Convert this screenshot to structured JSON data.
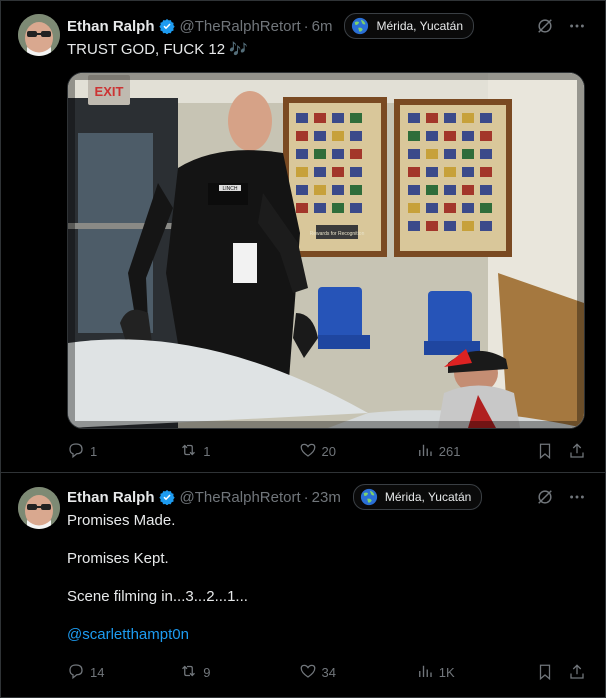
{
  "tweets": [
    {
      "author": {
        "name": "Ethan Ralph",
        "handle": "@TheRalphRetort"
      },
      "time": "6m",
      "location": "Mérida, Yucatán",
      "text": "TRUST GOD, FUCK 12 🎶",
      "media": {
        "exit_sign": "EXIT",
        "name_tag": "LINCH",
        "plaque": "Rewards for Recognition"
      },
      "stats": {
        "replies": "1",
        "reposts": "1",
        "likes": "20",
        "views": "261"
      }
    },
    {
      "author": {
        "name": "Ethan Ralph",
        "handle": "@TheRalphRetort"
      },
      "time": "23m",
      "location": "Mérida, Yucatán",
      "lines": [
        "Promises Made.",
        "Promises Kept.",
        "Scene filming in...3...2...1..."
      ],
      "mention": "@scarletthampt0n",
      "stats": {
        "replies": "14",
        "reposts": "9",
        "likes": "34",
        "views": "1K"
      }
    }
  ],
  "colors": {
    "background": "#000000",
    "text": "#e7e9ea",
    "muted": "#71767b",
    "accent": "#1d9bf0",
    "border": "#2f3336"
  },
  "icons": [
    "verified-badge-icon",
    "globe-icon",
    "grok-icon",
    "more-icon",
    "reply-icon",
    "repost-icon",
    "like-icon",
    "views-icon",
    "bookmark-icon",
    "share-icon"
  ]
}
